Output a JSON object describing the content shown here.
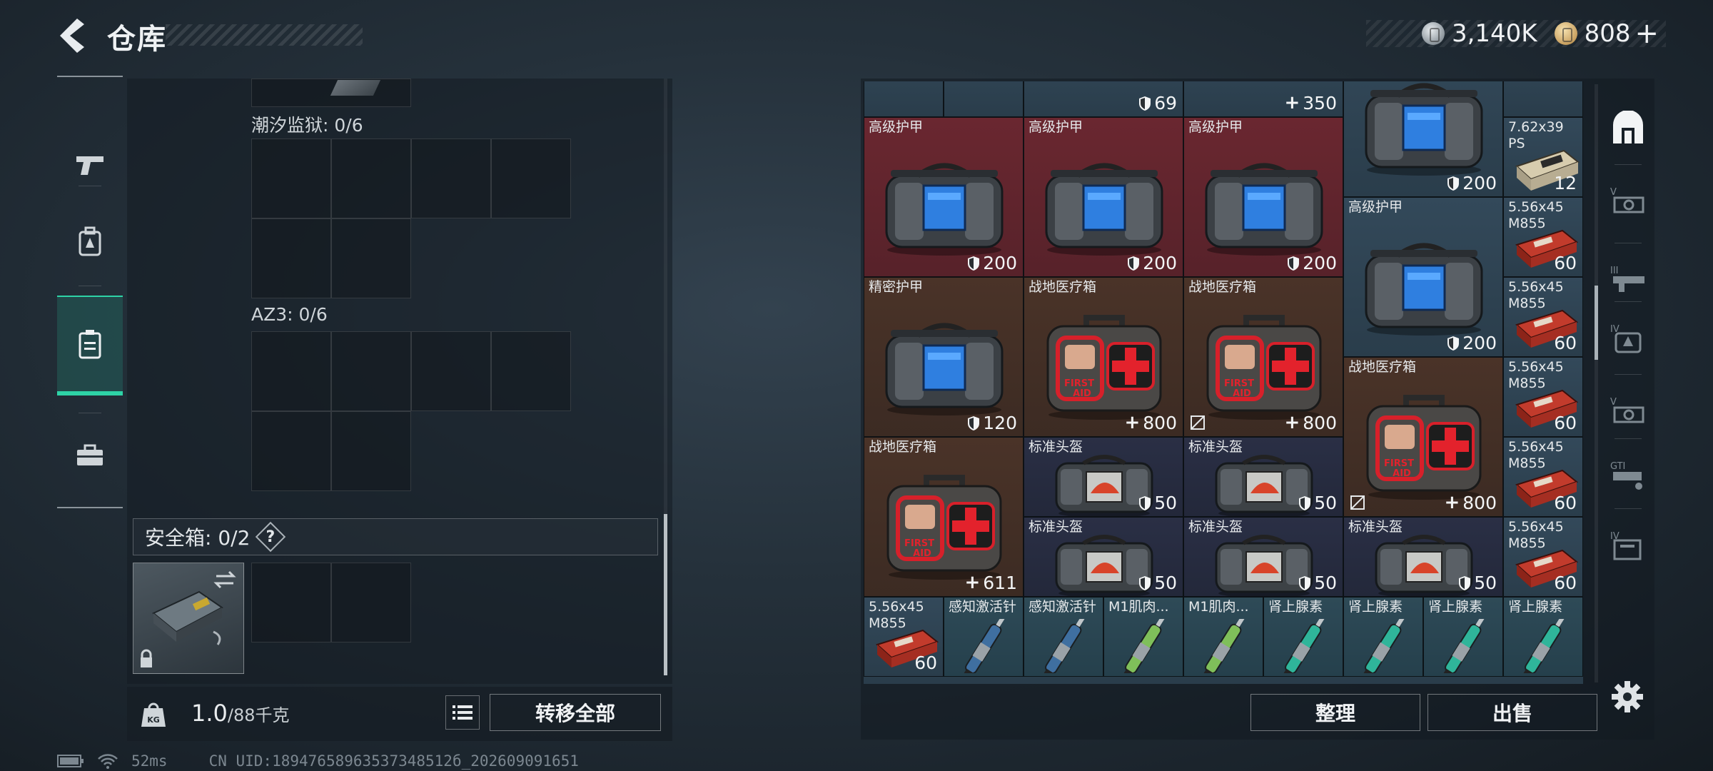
{
  "header": {
    "title": "仓库",
    "currencies": [
      {
        "icon": "silver-coin-icon",
        "value": "3,140K"
      },
      {
        "icon": "gold-coin-icon",
        "value": "808"
      }
    ],
    "add_symbol": "+"
  },
  "nav": {
    "items": [
      {
        "icon": "pistol-icon"
      },
      {
        "icon": "backpack-icon"
      },
      {
        "icon": "storage-icon",
        "active": true
      },
      {
        "icon": "briefcase-icon"
      }
    ]
  },
  "left_panel": {
    "sections": [
      {
        "label": "潮汐监狱: 0/6"
      },
      {
        "label": "AZ3: 0/6"
      }
    ],
    "safe": {
      "label": "安全箱: 0/2",
      "help": "?"
    },
    "weight": {
      "current": "1.0",
      "max": "/88千克"
    },
    "transfer_all": "转移全部"
  },
  "inventory": {
    "top_partial": [
      {
        "value": "69",
        "icon": "shield-icon"
      },
      {
        "value": "350",
        "icon": "plus-icon"
      }
    ],
    "items": [
      {
        "name": "高级护甲",
        "value": "200",
        "icon": "shield-icon"
      },
      {
        "name": "高级护甲",
        "value": "200",
        "icon": "shield-icon"
      },
      {
        "name": "高级护甲",
        "value": "200",
        "icon": "shield-icon"
      },
      {
        "name": "",
        "value": "200",
        "icon": "shield-icon"
      },
      {
        "name": "7.62x39 PS",
        "value": "12"
      },
      {
        "name": "高级护甲",
        "value": "200",
        "icon": "shield-icon"
      },
      {
        "name": "5.56x45 M855",
        "value": "60"
      },
      {
        "name": "精密护甲",
        "value": "120",
        "icon": "shield-icon"
      },
      {
        "name": "战地医疗箱",
        "value": "800",
        "icon": "plus-icon"
      },
      {
        "name": "战地医疗箱",
        "value": "800",
        "icon": "plus-icon"
      },
      {
        "name": "5.56x45 M855",
        "value": "60"
      },
      {
        "name": "战地医疗箱",
        "value": "800",
        "icon": "plus-icon"
      },
      {
        "name": "5.56x45 M855",
        "value": "60"
      },
      {
        "name": "战地医疗箱",
        "value": "611",
        "icon": "plus-icon"
      },
      {
        "name": "标准头盔",
        "value": "50",
        "icon": "shield-icon"
      },
      {
        "name": "标准头盔",
        "value": "50",
        "icon": "shield-icon"
      },
      {
        "name": "5.56x45 M855",
        "value": "60"
      },
      {
        "name": "标准头盔",
        "value": "50",
        "icon": "shield-icon"
      },
      {
        "name": "标准头盔",
        "value": "50",
        "icon": "shield-icon"
      },
      {
        "name": "标准头盔",
        "value": "50",
        "icon": "shield-icon"
      },
      {
        "name": "5.56x45 M855",
        "value": "60"
      },
      {
        "name": "5.56x45 M855",
        "value": "60"
      },
      {
        "name": "感知激活针",
        "value": ""
      },
      {
        "name": "感知激活针",
        "value": ""
      },
      {
        "name": "M1肌肉...",
        "value": ""
      },
      {
        "name": "M1肌肉...",
        "value": ""
      },
      {
        "name": "肾上腺素",
        "value": ""
      },
      {
        "name": "肾上腺素",
        "value": ""
      },
      {
        "name": "肾上腺素",
        "value": ""
      },
      {
        "name": "肾上腺素",
        "value": ""
      }
    ]
  },
  "categories": [
    {
      "icon": "vault-icon",
      "active": true
    },
    {
      "icon": "v-gun-icon"
    },
    {
      "icon": "iii-rifle-icon"
    },
    {
      "icon": "iv-armor-icon"
    },
    {
      "icon": "v-gun-icon-2"
    },
    {
      "icon": "gt-gun-icon"
    },
    {
      "icon": "iv-bag-icon"
    }
  ],
  "actions": {
    "sort": "整理",
    "sell": "出售"
  },
  "status": {
    "ping": "52ms",
    "uid": "CN UID:18947658963537348512б_202609091651"
  }
}
